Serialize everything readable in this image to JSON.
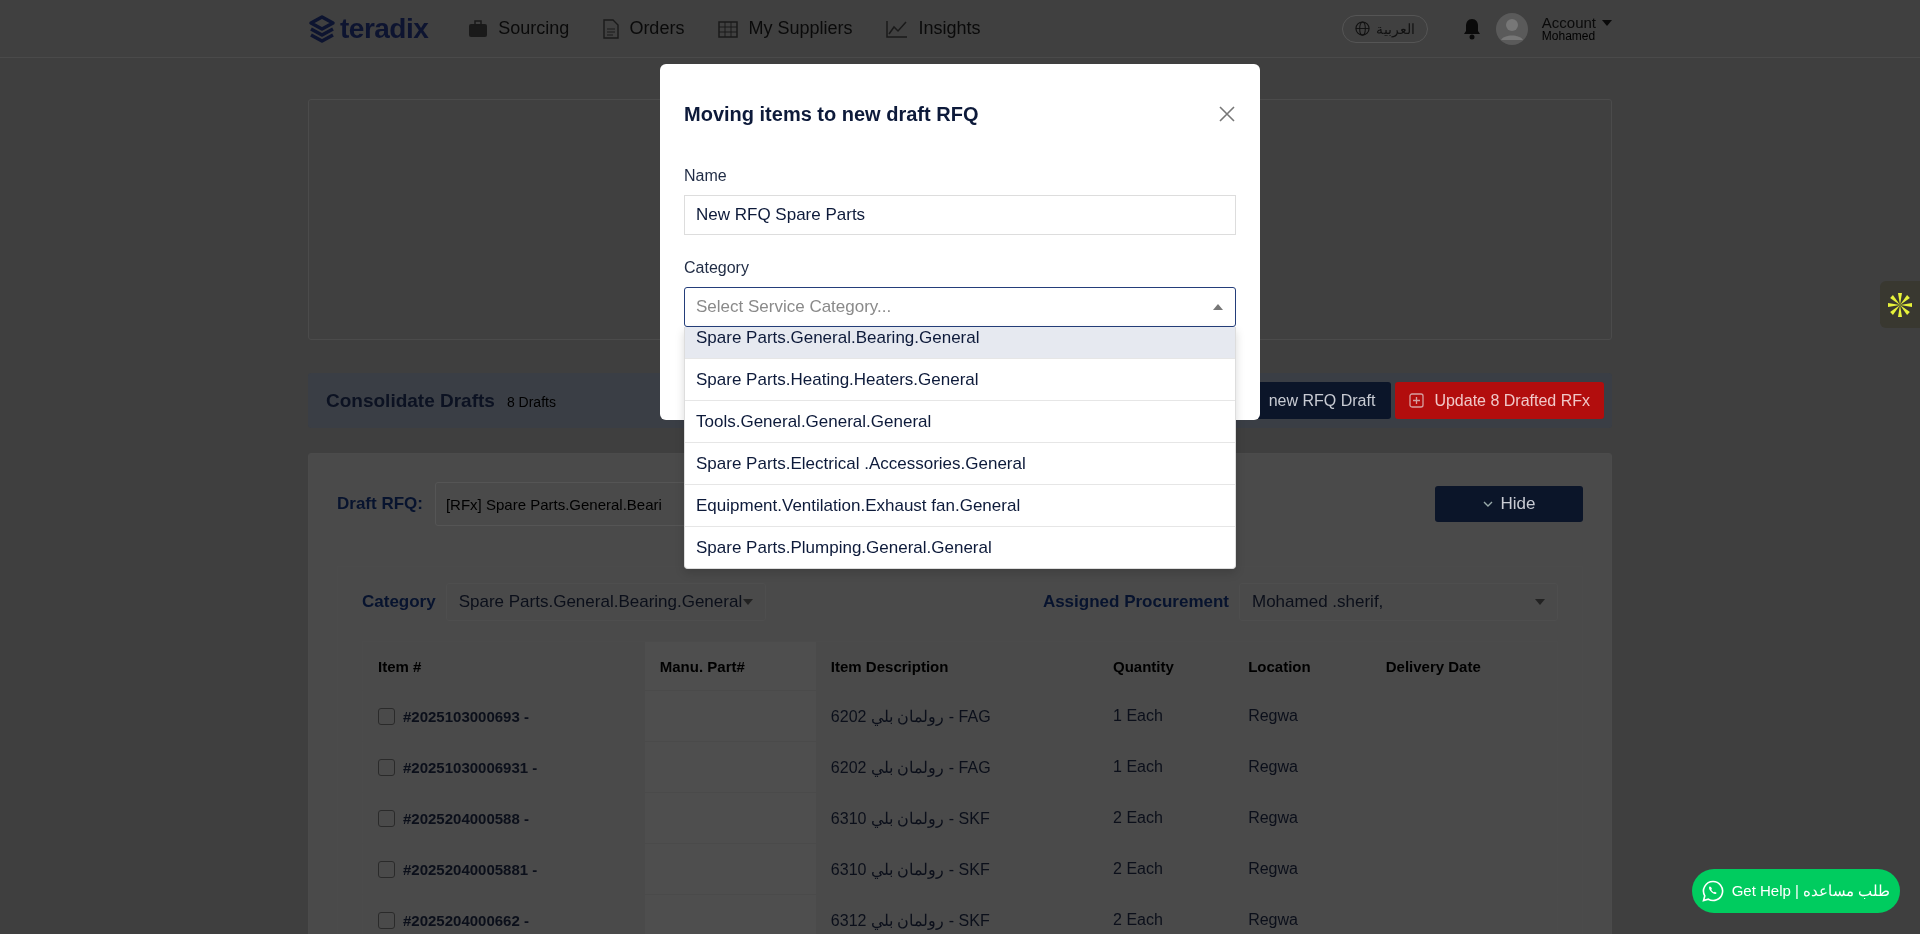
{
  "header": {
    "logo": "teradix",
    "nav": [
      {
        "label": "Sourcing",
        "kind": "briefcase"
      },
      {
        "label": "Orders",
        "kind": "document"
      },
      {
        "label": "My Suppliers",
        "kind": "building"
      },
      {
        "label": "Insights",
        "kind": "chart"
      }
    ],
    "language": "العربية",
    "account": {
      "label": "Account",
      "name": "Mohamed"
    }
  },
  "consolidate": {
    "title": "Consolidate Drafts",
    "count": "8 Drafts",
    "buttons": [
      {
        "label": "new RFQ Draft",
        "kind": "primary"
      },
      {
        "label": "Update 8 Drafted RFx",
        "kind": "danger"
      }
    ]
  },
  "draft": {
    "label": "Draft RFQ:",
    "value": "[RFx] Spare Parts.General.Beari",
    "hide_button": "Hide"
  },
  "filters": {
    "category_label": "Category",
    "category_value": "Spare Parts.General.Bearing.General",
    "procurement_label": "Assigned Procurement",
    "procurement_value": "Mohamed .sherif,"
  },
  "table": {
    "columns": [
      "Item #",
      "Manu. Part#",
      "Item Description",
      "Quantity",
      "Location",
      "Delivery Date"
    ],
    "rows": [
      {
        "item": "#2025103000693 -",
        "part": "",
        "description": "رولمان بلي 6202 - FAG",
        "quantity": "1 Each",
        "location": "Regwa",
        "checked": false
      },
      {
        "item": "#20251030006931 -",
        "part": "",
        "description": "رولمان بلي 6202 - FAG",
        "quantity": "1 Each",
        "location": "Regwa",
        "checked": false
      },
      {
        "item": "#2025204000588 -",
        "part": "",
        "description": "رولمان بلي 6310 - SKF",
        "quantity": "2 Each",
        "location": "Regwa",
        "checked": false
      },
      {
        "item": "#20252040005881 -",
        "part": "",
        "description": "رولمان بلي 6310 - SKF",
        "quantity": "2 Each",
        "location": "Regwa",
        "checked": false
      },
      {
        "item": "#2025204000662 -",
        "part": "",
        "description": "رولمان بلي 6312 - SKF",
        "quantity": "2 Each",
        "location": "Regwa",
        "checked": false
      }
    ]
  },
  "modal": {
    "title": "Moving items to new draft RFQ",
    "name_label": "Name",
    "name_value": "New RFQ Spare Parts",
    "category_label": "Category",
    "category_placeholder": "Select Service Category...",
    "options": [
      {
        "label": "Spare Parts.General.Bearing.General",
        "selected": true
      },
      {
        "label": "Spare Parts.Heating.Heaters.General",
        "selected": false
      },
      {
        "label": "Tools.General.General.General",
        "selected": false
      },
      {
        "label": "Spare Parts.Electrical .Accessories.General",
        "selected": false
      },
      {
        "label": "Equipment.Ventilation.Exhaust fan.General",
        "selected": false
      },
      {
        "label": "Spare Parts.Plumping.General.General",
        "selected": false
      }
    ]
  },
  "help_button": "Get Help | طلب مساعده"
}
